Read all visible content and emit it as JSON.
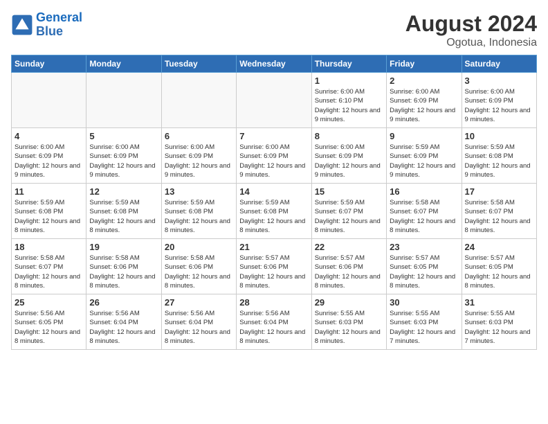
{
  "header": {
    "logo_general": "General",
    "logo_blue": "Blue",
    "title": "August 2024",
    "subtitle": "Ogotua, Indonesia"
  },
  "days_of_week": [
    "Sunday",
    "Monday",
    "Tuesday",
    "Wednesday",
    "Thursday",
    "Friday",
    "Saturday"
  ],
  "weeks": [
    [
      {
        "day": "",
        "info": ""
      },
      {
        "day": "",
        "info": ""
      },
      {
        "day": "",
        "info": ""
      },
      {
        "day": "",
        "info": ""
      },
      {
        "day": "1",
        "info": "Sunrise: 6:00 AM\nSunset: 6:10 PM\nDaylight: 12 hours\nand 9 minutes."
      },
      {
        "day": "2",
        "info": "Sunrise: 6:00 AM\nSunset: 6:09 PM\nDaylight: 12 hours\nand 9 minutes."
      },
      {
        "day": "3",
        "info": "Sunrise: 6:00 AM\nSunset: 6:09 PM\nDaylight: 12 hours\nand 9 minutes."
      }
    ],
    [
      {
        "day": "4",
        "info": "Sunrise: 6:00 AM\nSunset: 6:09 PM\nDaylight: 12 hours\nand 9 minutes."
      },
      {
        "day": "5",
        "info": "Sunrise: 6:00 AM\nSunset: 6:09 PM\nDaylight: 12 hours\nand 9 minutes."
      },
      {
        "day": "6",
        "info": "Sunrise: 6:00 AM\nSunset: 6:09 PM\nDaylight: 12 hours\nand 9 minutes."
      },
      {
        "day": "7",
        "info": "Sunrise: 6:00 AM\nSunset: 6:09 PM\nDaylight: 12 hours\nand 9 minutes."
      },
      {
        "day": "8",
        "info": "Sunrise: 6:00 AM\nSunset: 6:09 PM\nDaylight: 12 hours\nand 9 minutes."
      },
      {
        "day": "9",
        "info": "Sunrise: 5:59 AM\nSunset: 6:09 PM\nDaylight: 12 hours\nand 9 minutes."
      },
      {
        "day": "10",
        "info": "Sunrise: 5:59 AM\nSunset: 6:08 PM\nDaylight: 12 hours\nand 9 minutes."
      }
    ],
    [
      {
        "day": "11",
        "info": "Sunrise: 5:59 AM\nSunset: 6:08 PM\nDaylight: 12 hours\nand 8 minutes."
      },
      {
        "day": "12",
        "info": "Sunrise: 5:59 AM\nSunset: 6:08 PM\nDaylight: 12 hours\nand 8 minutes."
      },
      {
        "day": "13",
        "info": "Sunrise: 5:59 AM\nSunset: 6:08 PM\nDaylight: 12 hours\nand 8 minutes."
      },
      {
        "day": "14",
        "info": "Sunrise: 5:59 AM\nSunset: 6:08 PM\nDaylight: 12 hours\nand 8 minutes."
      },
      {
        "day": "15",
        "info": "Sunrise: 5:59 AM\nSunset: 6:07 PM\nDaylight: 12 hours\nand 8 minutes."
      },
      {
        "day": "16",
        "info": "Sunrise: 5:58 AM\nSunset: 6:07 PM\nDaylight: 12 hours\nand 8 minutes."
      },
      {
        "day": "17",
        "info": "Sunrise: 5:58 AM\nSunset: 6:07 PM\nDaylight: 12 hours\nand 8 minutes."
      }
    ],
    [
      {
        "day": "18",
        "info": "Sunrise: 5:58 AM\nSunset: 6:07 PM\nDaylight: 12 hours\nand 8 minutes."
      },
      {
        "day": "19",
        "info": "Sunrise: 5:58 AM\nSunset: 6:06 PM\nDaylight: 12 hours\nand 8 minutes."
      },
      {
        "day": "20",
        "info": "Sunrise: 5:58 AM\nSunset: 6:06 PM\nDaylight: 12 hours\nand 8 minutes."
      },
      {
        "day": "21",
        "info": "Sunrise: 5:57 AM\nSunset: 6:06 PM\nDaylight: 12 hours\nand 8 minutes."
      },
      {
        "day": "22",
        "info": "Sunrise: 5:57 AM\nSunset: 6:06 PM\nDaylight: 12 hours\nand 8 minutes."
      },
      {
        "day": "23",
        "info": "Sunrise: 5:57 AM\nSunset: 6:05 PM\nDaylight: 12 hours\nand 8 minutes."
      },
      {
        "day": "24",
        "info": "Sunrise: 5:57 AM\nSunset: 6:05 PM\nDaylight: 12 hours\nand 8 minutes."
      }
    ],
    [
      {
        "day": "25",
        "info": "Sunrise: 5:56 AM\nSunset: 6:05 PM\nDaylight: 12 hours\nand 8 minutes."
      },
      {
        "day": "26",
        "info": "Sunrise: 5:56 AM\nSunset: 6:04 PM\nDaylight: 12 hours\nand 8 minutes."
      },
      {
        "day": "27",
        "info": "Sunrise: 5:56 AM\nSunset: 6:04 PM\nDaylight: 12 hours\nand 8 minutes."
      },
      {
        "day": "28",
        "info": "Sunrise: 5:56 AM\nSunset: 6:04 PM\nDaylight: 12 hours\nand 8 minutes."
      },
      {
        "day": "29",
        "info": "Sunrise: 5:55 AM\nSunset: 6:03 PM\nDaylight: 12 hours\nand 8 minutes."
      },
      {
        "day": "30",
        "info": "Sunrise: 5:55 AM\nSunset: 6:03 PM\nDaylight: 12 hours\nand 7 minutes."
      },
      {
        "day": "31",
        "info": "Sunrise: 5:55 AM\nSunset: 6:03 PM\nDaylight: 12 hours\nand 7 minutes."
      }
    ]
  ]
}
